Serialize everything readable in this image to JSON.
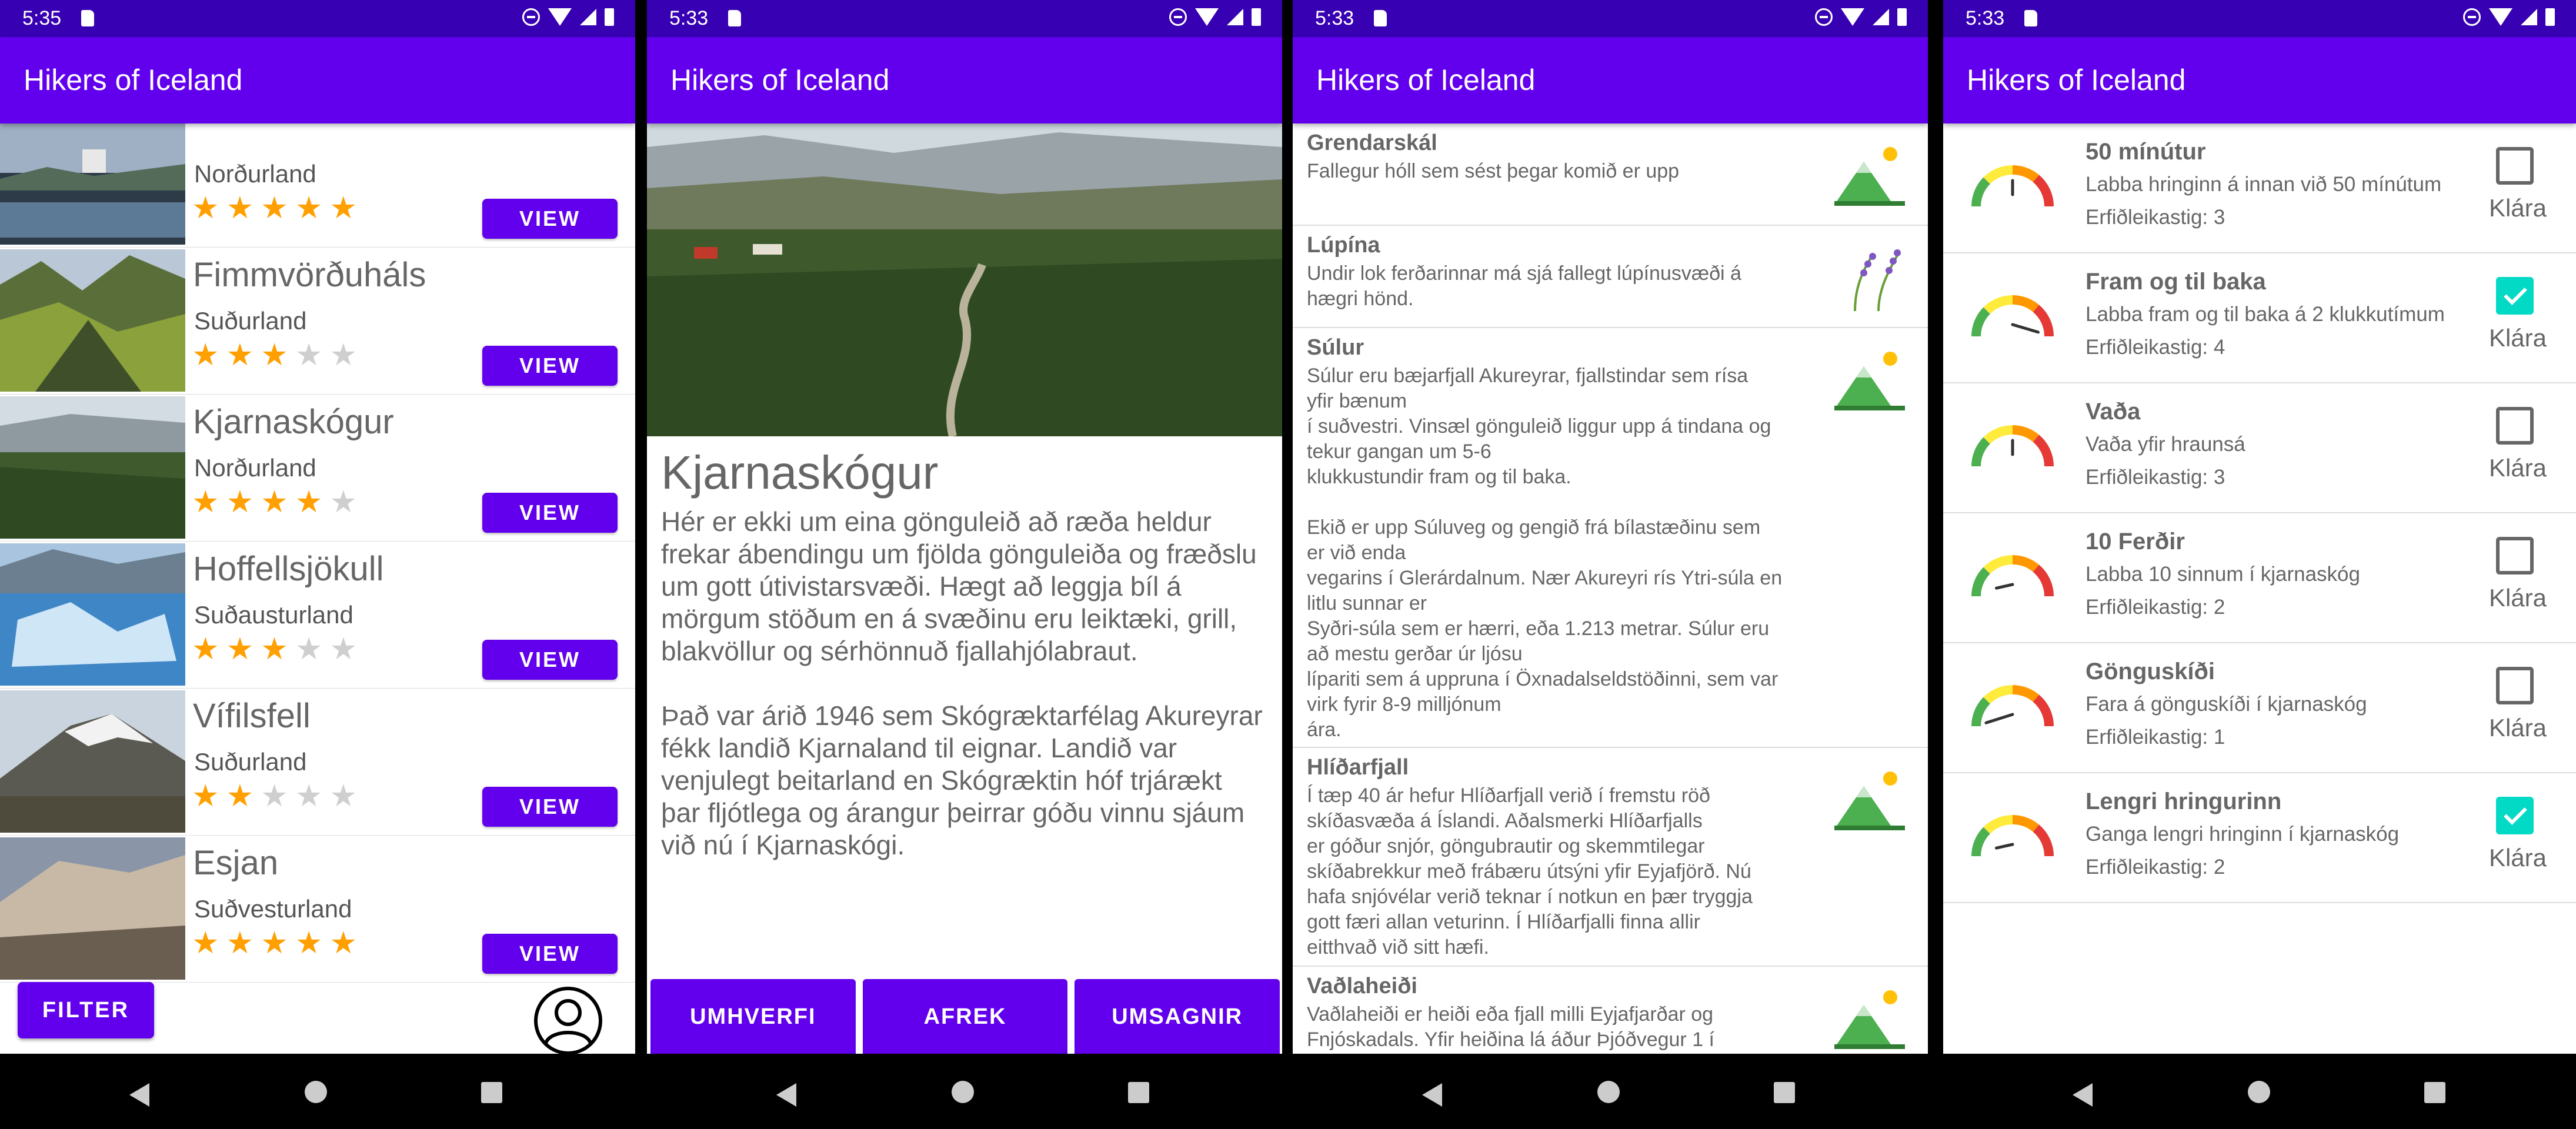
{
  "app_title": "Hikers of Iceland",
  "colors": {
    "status_bar": "#3700b3",
    "app_bar": "#6200ee",
    "star_on": "#ffa000",
    "star_off": "#cfcfcf",
    "check": "#03dac5"
  },
  "screens": [
    {
      "time": "5:35",
      "trails": [
        {
          "name": "",
          "region": "Norðurland",
          "rating": 5,
          "view_label": "VIEW"
        },
        {
          "name": "Fimmvörðuháls",
          "region": "Suðurland",
          "rating": 3,
          "view_label": "VIEW"
        },
        {
          "name": "Kjarnaskógur",
          "region": "Norðurland",
          "rating": 4,
          "view_label": "VIEW"
        },
        {
          "name": "Hoffellsjökull",
          "region": "Suðausturland",
          "rating": 3,
          "view_label": "VIEW"
        },
        {
          "name": "Vífilsfell",
          "region": "Suðurland",
          "rating": 2,
          "view_label": "VIEW"
        },
        {
          "name": "Esjan",
          "region": "Suðvesturland",
          "rating": 5,
          "view_label": "VIEW"
        }
      ],
      "filter_label": "FILTER",
      "profile_icon": "account-circle-icon"
    },
    {
      "time": "5:33",
      "detail_title": "Kjarnaskógur",
      "detail_body": "Hér er ekki um eina gönguleið að ræða heldur frekar ábendingu um fjölda gönguleiða og fræðslu um gott útivistarsvæði. Hægt að leggja bíl á mörgum stöðum en á svæðinu eru leiktæki, grill, blakvöllur og sérhönnuð fjallahjólabraut.\n\nÞað var árið 1946 sem Skógræktarfélag Akureyrar fékk landið Kjarnaland til eignar. Landið var venjulegt beitarland en Skógræktin hóf trjárækt þar fljótlega og árangur þeirrar góðu vinnu sjáum við nú í Kjarnaskógi.",
      "tabs": [
        "UMHVERFI",
        "AFREK",
        "UMSAGNIR"
      ]
    },
    {
      "time": "5:33",
      "info_items": [
        {
          "title": "Grendarskál",
          "text": "Fallegur hóll sem sést þegar komið er upp",
          "icon": "mountain-sun-icon"
        },
        {
          "title": "Lúpína",
          "text": "Undir lok ferðarinnar má sjá fallegt lúpínusvæði á\nhægri hönd.",
          "icon": "lupine-flower-icon"
        },
        {
          "title": "Súlur",
          "text": "Súlur eru bæjarfjall Akureyrar, fjallstindar sem rísa\nyfir bænum\ní suðvestri. Vinsæl gönguleið liggur upp á tindana og\ntekur gangan um 5-6\nklukkustundir fram og til baka.\n\nEkið er upp Súluveg og gengið frá bílastæðinu sem\ner við enda\nvegarins í Glerárdalnum. Nær Akureyri rís Ytri-súla en\nlitlu sunnar er\nSyðri-súla sem er hærri, eða 1.213 metrar. Súlur eru\nað mestu gerðar úr ljósu\nlípariti sem á uppruna í Öxnadalseldstöðinni, sem var\nvirk fyrir 8-9 milljónum\nára.",
          "icon": "mountain-sun-icon"
        },
        {
          "title": "Hlíðarfjall",
          "text": "Í tæp 40 ár hefur Hlíðarfjall verið í fremstu röð\nskíðasvæða á Íslandi. Aðalsmerki Hlíðarfjalls\ner góður snjór, göngubrautir og skemmtilegar\nskíðabrekkur með frábæru útsýni yfir Eyjafjörð. Nú\nhafa snjóvélar verið teknar í notkun en þær tryggja\ngott færi allan veturinn. Í Hlíðarfjalli finna allir\neitthvað við sitt hæfi.",
          "icon": "mountain-sun-icon"
        },
        {
          "title": "Vaðlaheiði",
          "text": "Vaðlaheiði er heiði eða fjall milli Eyjafjarðar og\nFnjóskadals. Yfir heiðina lá áður Þjóðvegur 1 í",
          "icon": "mountain-sun-icon"
        }
      ]
    },
    {
      "time": "5:33",
      "achievements": [
        {
          "title": "50 mínútur",
          "desc": "Labba hringinn á innan við 50 mínútum",
          "difficulty": "Erfiðleikastig: 3",
          "level": 3,
          "checked": false,
          "done_label": "Klára"
        },
        {
          "title": "Fram og til baka",
          "desc": "Labba fram og til baka á 2 klukkutímum",
          "difficulty": "Erfiðleikastig: 4",
          "level": 4,
          "checked": true,
          "done_label": "Klára"
        },
        {
          "title": "Vaða",
          "desc": "Vaða yfir hraunsá",
          "difficulty": "Erfiðleikastig: 3",
          "level": 3,
          "checked": false,
          "done_label": "Klára"
        },
        {
          "title": "10 Ferðir",
          "desc": "Labba 10 sinnum í kjarnaskóg",
          "difficulty": "Erfiðleikastig: 2",
          "level": 2,
          "checked": false,
          "done_label": "Klára"
        },
        {
          "title": "Gönguskíði",
          "desc": "Fara á gönguskíði í kjarnaskóg",
          "difficulty": "Erfiðleikastig: 1",
          "level": 1,
          "checked": false,
          "done_label": "Klára"
        },
        {
          "title": "Lengri hringurinn",
          "desc": "Ganga lengri hringinn í kjarnaskóg",
          "difficulty": "Erfiðleikastig: 2",
          "level": 2,
          "checked": true,
          "done_label": "Klára"
        }
      ]
    }
  ]
}
